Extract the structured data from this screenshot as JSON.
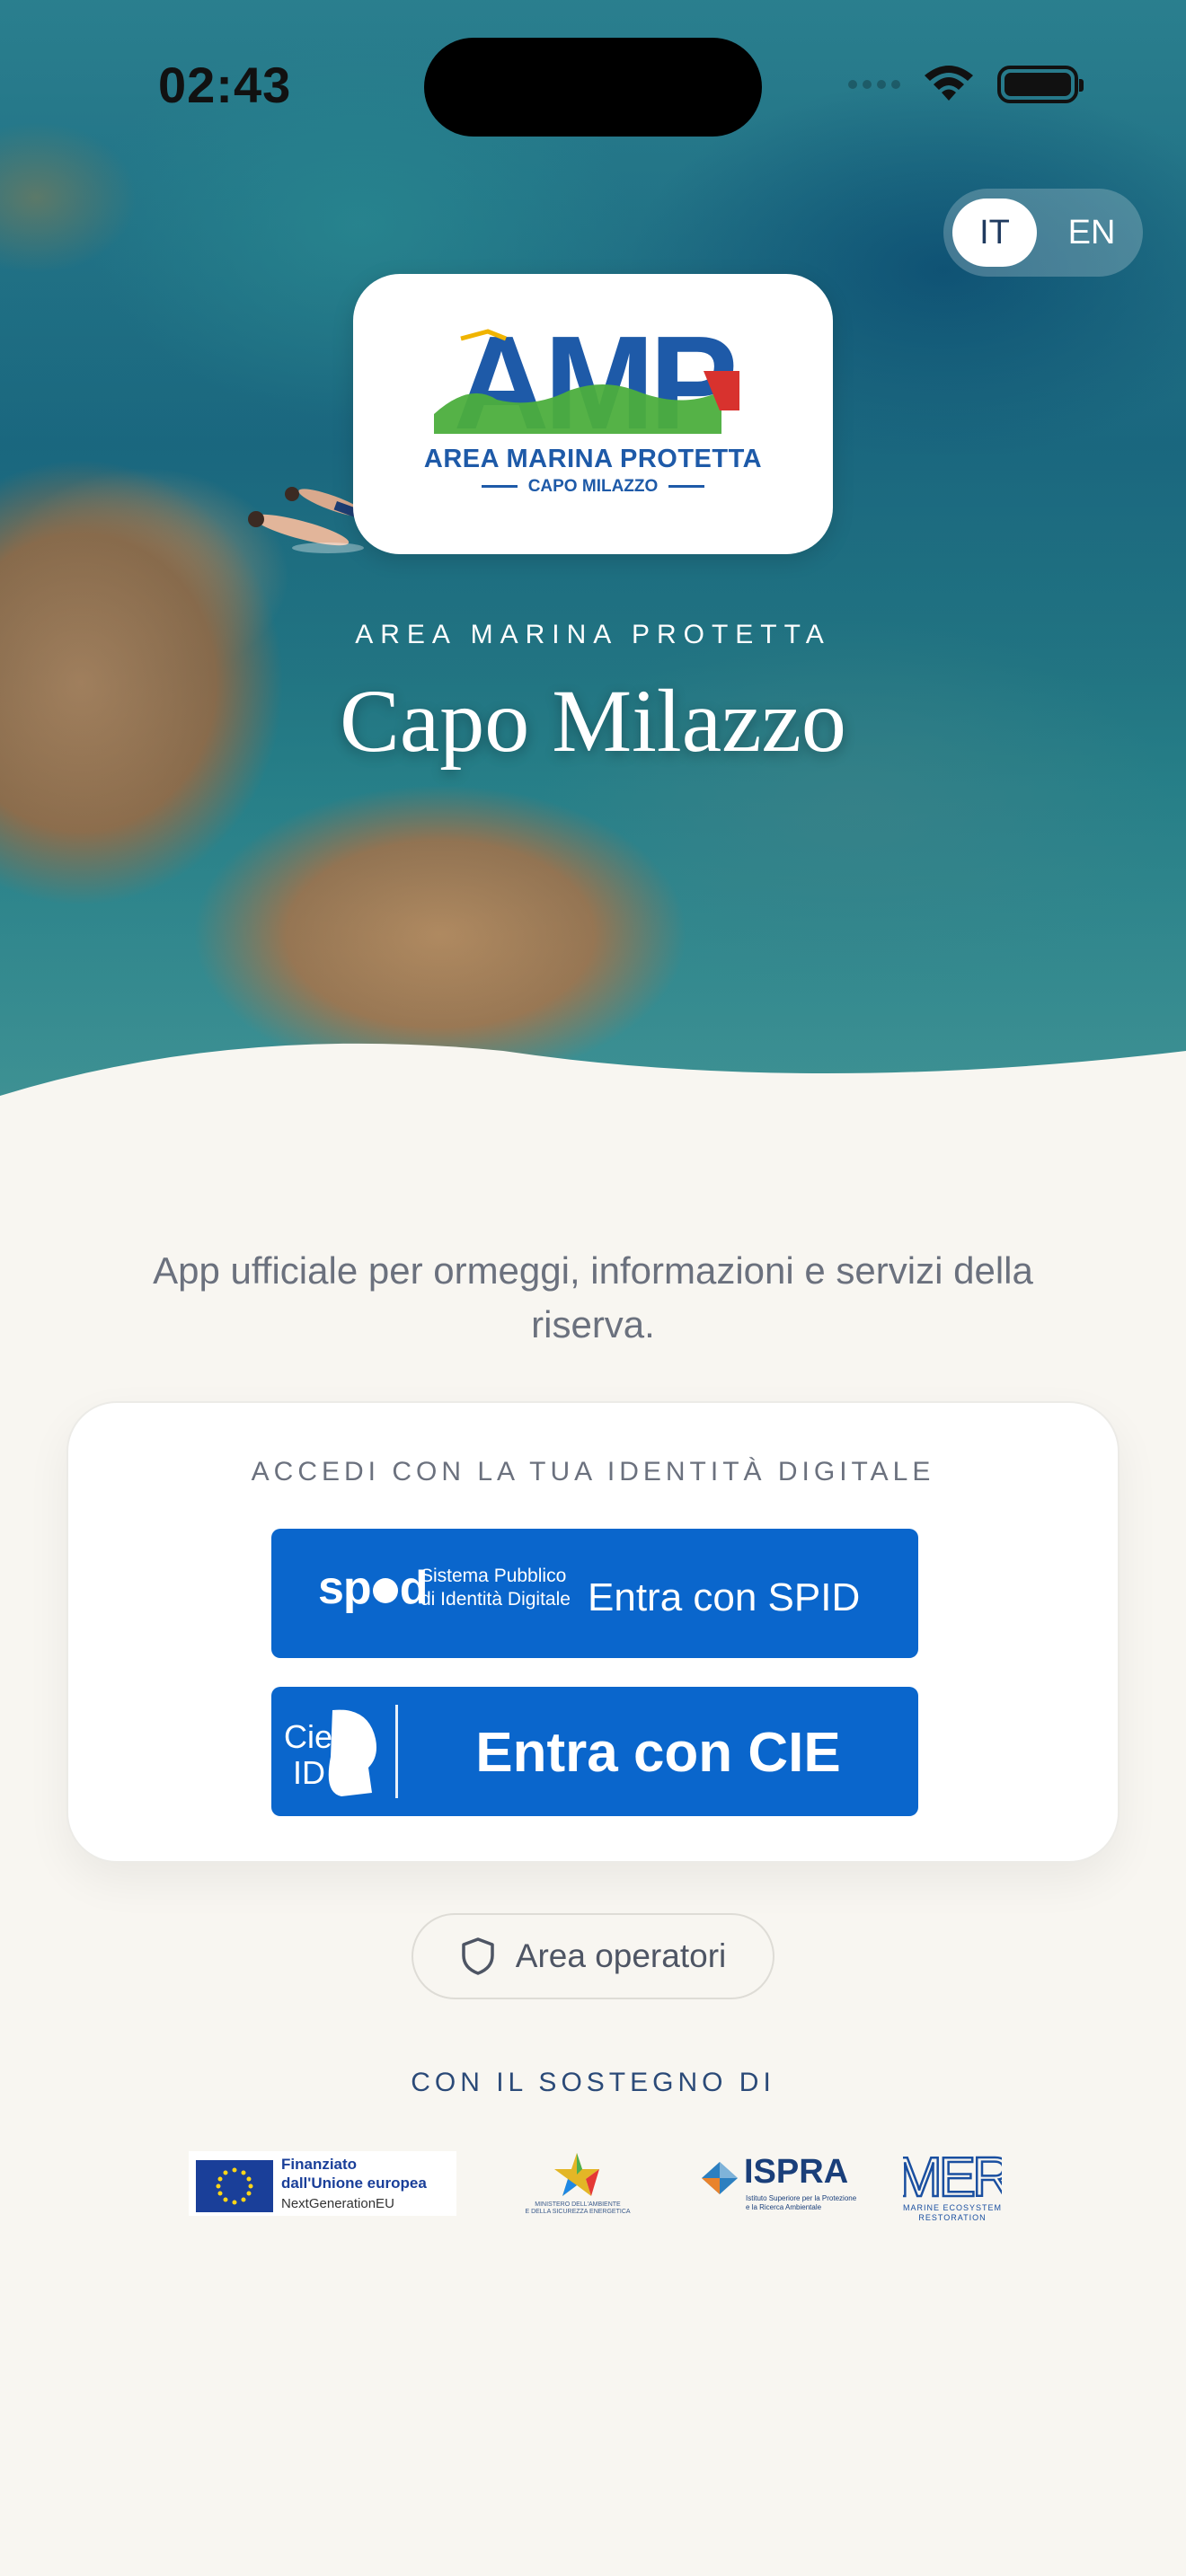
{
  "status_bar": {
    "time": "02:43"
  },
  "language": {
    "options": [
      "IT",
      "EN"
    ],
    "selected": "IT"
  },
  "logo": {
    "mark": "AMP",
    "line1": "AREA MARINA PROTETTA",
    "line2": "CAPO MILAZZO"
  },
  "hero": {
    "subtitle": "AREA MARINA PROTETTA",
    "title": "Capo Milazzo"
  },
  "intro": "App ufficiale per ormeggi, informazioni e servizi della riserva.",
  "login": {
    "heading": "ACCEDI CON LA TUA IDENTITÀ DIGITALE",
    "spid": {
      "logo_text": "sp",
      "logo_text_end": "d",
      "small_line1": "Sistema Pubblico",
      "small_line2": "di Identità Digitale",
      "label": "Entra con SPID"
    },
    "cie": {
      "logo_text1": "Cie",
      "logo_text2": "ID",
      "label": "Entra con CIE"
    }
  },
  "operators": {
    "label": "Area operatori",
    "icon": "shield-icon"
  },
  "support": {
    "heading": "CON IL SOSTEGNO DI",
    "eu": {
      "line1": "Finanziato",
      "line2": "dall'Unione europea",
      "line3": "NextGenerationEU"
    },
    "mase": {
      "line1": "MINISTERO DELL'AMBIENTE",
      "line2": "E DELLA SICUREZZA ENERGETICA"
    },
    "ispra": {
      "name": "ISPRA",
      "line1": "Istituto Superiore per la Protezione",
      "line2": "e la Ricerca Ambientale"
    },
    "mer": {
      "mark": "MER",
      "line1": "MARINE ECOSYSTEM",
      "line2": "RESTORATION"
    }
  },
  "colors": {
    "brand_blue": "#0a66cc",
    "background": "#f8f6f1",
    "text_muted": "#6b717e",
    "navy": "#2b4a78"
  }
}
